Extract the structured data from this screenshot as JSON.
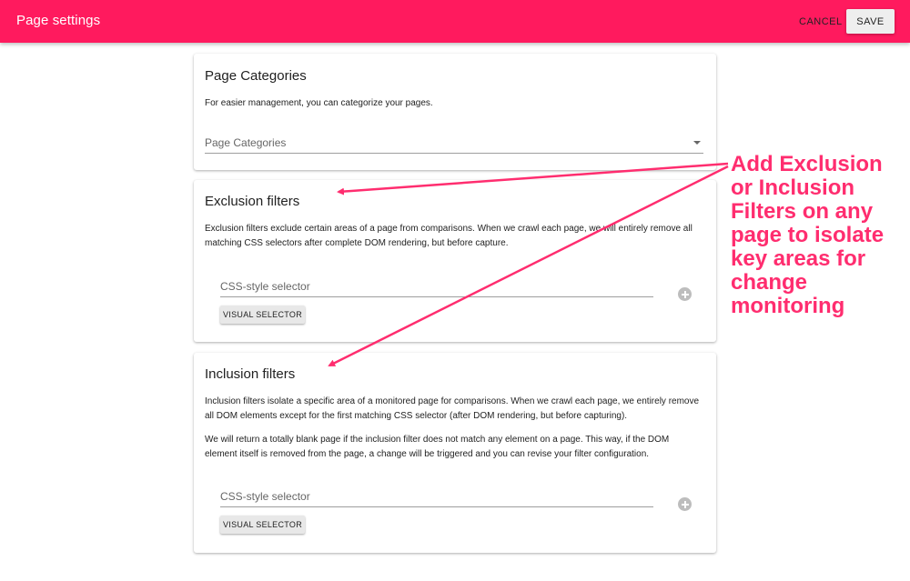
{
  "appbar": {
    "title": "Page settings",
    "cancel_label": "CANCEL",
    "save_label": "SAVE",
    "color": "#ff1a5e"
  },
  "categories": {
    "title": "Page Categories",
    "description": "For easier management, you can categorize your pages.",
    "select_label": "Page Categories"
  },
  "exclusion": {
    "title": "Exclusion filters",
    "description": "Exclusion filters exclude certain areas of a page from comparisons. When we crawl each page, we will entirely remove all matching CSS selectors after complete DOM rendering, but before capture.",
    "input_placeholder": "CSS-style selector",
    "visual_selector_label": "VISUAL SELECTOR"
  },
  "inclusion": {
    "title": "Inclusion filters",
    "description_1": "Inclusion filters isolate a specific area of a monitored page for comparisons. When we crawl each page, we entirely remove all DOM elements except for the first matching CSS selector (after DOM rendering, but before capturing).",
    "description_2": "We will return a totally blank page if the inclusion filter does not match any element on a page. This way, if the DOM element itself is removed from the page, a change will be triggered and you can revise your filter configuration.",
    "input_placeholder": "CSS-style selector",
    "visual_selector_label": "VISUAL SELECTOR"
  },
  "annotation": {
    "text": "Add Exclusion or Inclusion Filters on any page to isolate key areas for change monitoring",
    "color": "#ff2d6f"
  },
  "icons": {
    "add": "add-circle-icon",
    "dropdown": "caret-down-icon"
  }
}
